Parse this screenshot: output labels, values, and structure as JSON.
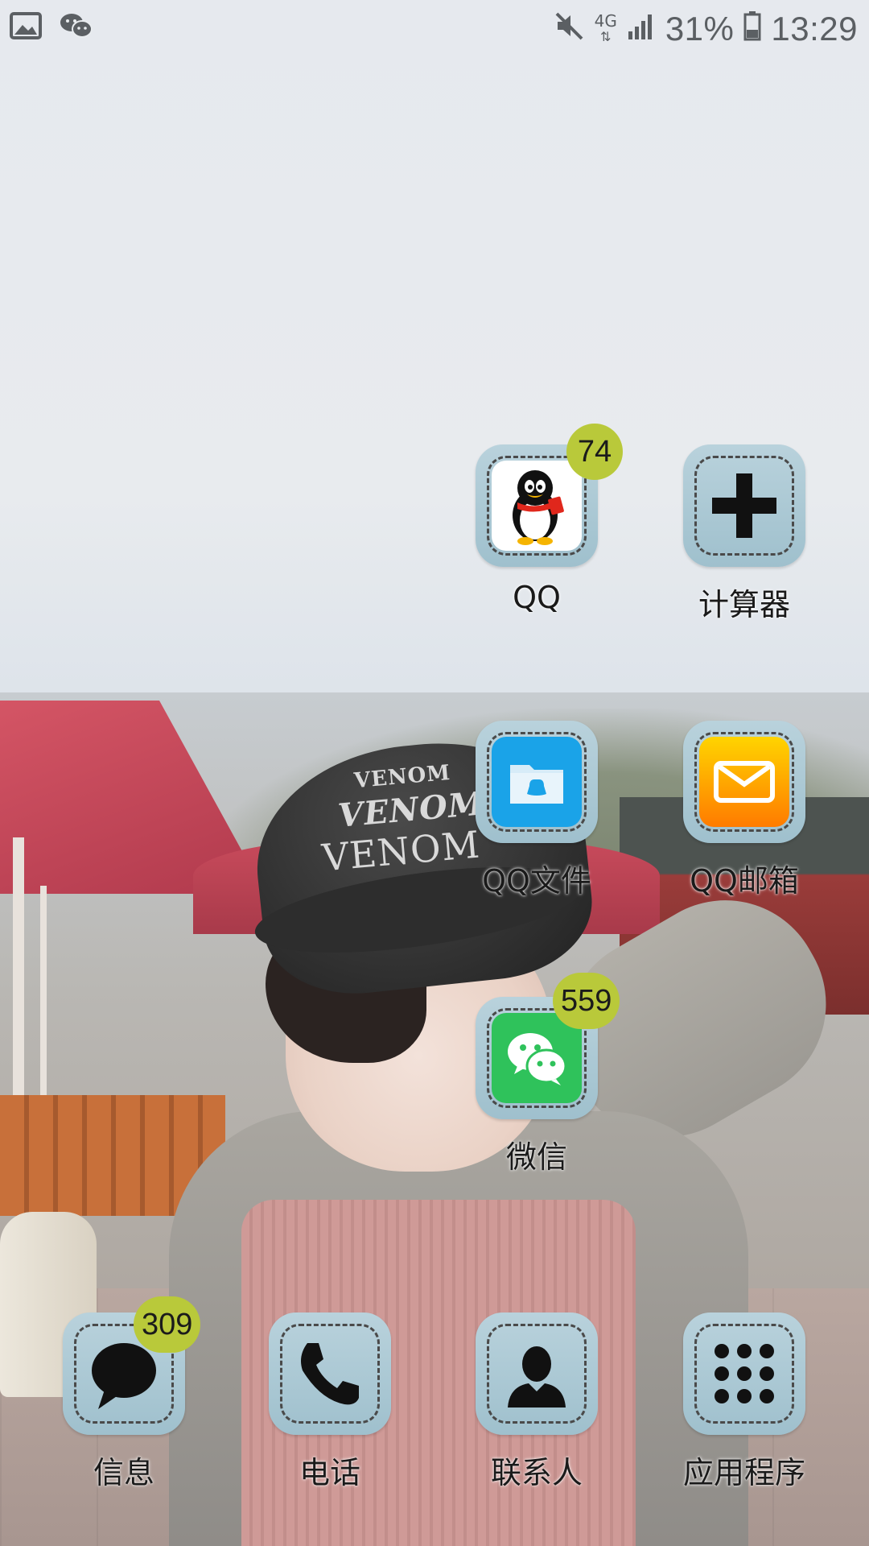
{
  "status_bar": {
    "left_icons": [
      "image-icon",
      "wechat-icon"
    ],
    "network": "4G",
    "battery": "31%",
    "time": "13:29"
  },
  "apps": [
    {
      "id": "qq",
      "label": "QQ",
      "badge": "74",
      "icon": "qq-penguin-icon"
    },
    {
      "id": "calculator",
      "label": "计算器",
      "badge": null,
      "icon": "plus-icon"
    },
    {
      "id": "qq-files",
      "label": "QQ文件",
      "badge": null,
      "icon": "folder-icon"
    },
    {
      "id": "qq-mail",
      "label": "QQ邮箱",
      "badge": null,
      "icon": "mail-icon"
    },
    {
      "id": "wechat",
      "label": "微信",
      "badge": "559",
      "icon": "wechat-icon"
    }
  ],
  "dock": [
    {
      "id": "messages",
      "label": "信息",
      "badge": "309",
      "icon": "message-bubble-icon"
    },
    {
      "id": "phone",
      "label": "电话",
      "badge": null,
      "icon": "phone-icon"
    },
    {
      "id": "contacts",
      "label": "联系人",
      "badge": null,
      "icon": "contact-icon"
    },
    {
      "id": "apps",
      "label": "应用程序",
      "badge": null,
      "icon": "app-grid-icon"
    }
  ],
  "wallpaper_text": [
    "VENOM",
    "VENOM",
    "VENOM"
  ],
  "colors": {
    "badge": "#b9c93a",
    "tile": "#a9c8d4",
    "wechat": "#2fc25b",
    "qq_files": "#1aa3e8"
  }
}
